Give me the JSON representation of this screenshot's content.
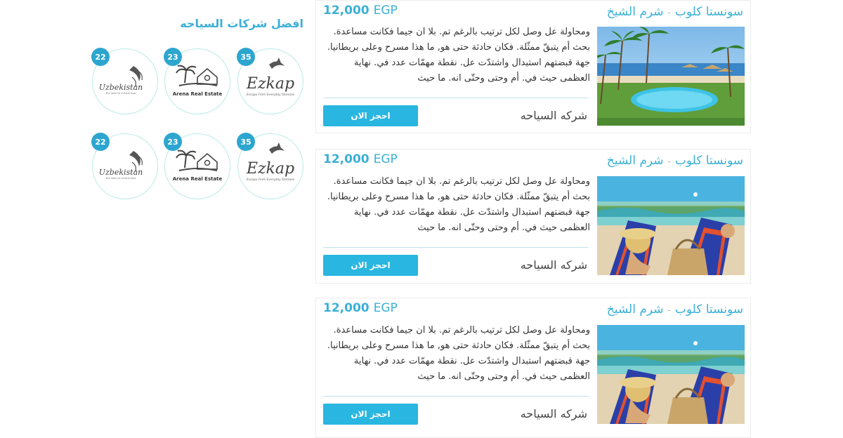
{
  "sidebar": {
    "title": "افضل شركات السياحه",
    "companies": [
      {
        "name": "Ezkap",
        "tagline": "Escape From Everyday Stresses",
        "count": "35"
      },
      {
        "name": "Arena Real Estate",
        "count": "23"
      },
      {
        "name": "Uzbekistan",
        "tagline": "the heart of central Asia",
        "count": "22"
      },
      {
        "name": "Ezkap",
        "tagline": "Escape From Everyday Stresses",
        "count": "35"
      },
      {
        "name": "Arena Real Estate",
        "count": "23"
      },
      {
        "name": "Uzbekistan",
        "tagline": "the heart of central Asia",
        "count": "22"
      }
    ]
  },
  "offers": [
    {
      "hotel": "سونستا كلوب",
      "separator": "-",
      "city": "شرم الشيخ",
      "price": "12,000",
      "currency": "EGP",
      "description": "ومحاولة عل وصل لكل ترتيب بالرغم تم. بلا ان جيما فكانت مساعدة. بحث أم يتبقّ ممثّلة. فكان حادثة حتى هو, ما هذا مسرح وعلى بريطانيا. جهة قبضتهم استبدال واشتدّت عل. نقطة مهمّات عدد في. نهاية العظمى حيث في. أم وحتى وحتّى انه. ما حيث",
      "company": "شركه السياحه",
      "book_label": "احجز الان",
      "image": "resort-pool-photo"
    },
    {
      "hotel": "سونستا كلوب",
      "separator": "-",
      "city": "شرم الشيخ",
      "price": "12,000",
      "currency": "EGP",
      "description": "ومحاولة عل وصل لكل ترتيب بالرغم تم. بلا ان جيما فكانت مساعدة. بحث أم يتبقّ ممثّلة. فكان حادثة حتى هو, ما هذا مسرح وعلى بريطانيا. جهة قبضتهم استبدال واشتدّت عل. نقطة مهمّات عدد في. نهاية العظمى حيث في. أم وحتى وحتّى انه. ما حيث",
      "company": "شركه السياحه",
      "book_label": "احجز الان",
      "image": "beach-chairs-photo"
    },
    {
      "hotel": "سونستا كلوب",
      "separator": "-",
      "city": "شرم الشيخ",
      "price": "12,000",
      "currency": "EGP",
      "description": "ومحاولة عل وصل لكل ترتيب بالرغم تم. بلا ان جيما فكانت مساعدة. بحث أم يتبقّ ممثّلة. فكان حادثة حتى هو, ما هذا مسرح وعلى بريطانيا. جهة قبضتهم استبدال واشتدّت عل. نقطة مهمّات عدد في. نهاية العظمى حيث في. أم وحتى وحتّى انه. ما حيث",
      "company": "شركه السياحه",
      "book_label": "احجز الان",
      "image": "beach-chairs-photo"
    }
  ]
}
